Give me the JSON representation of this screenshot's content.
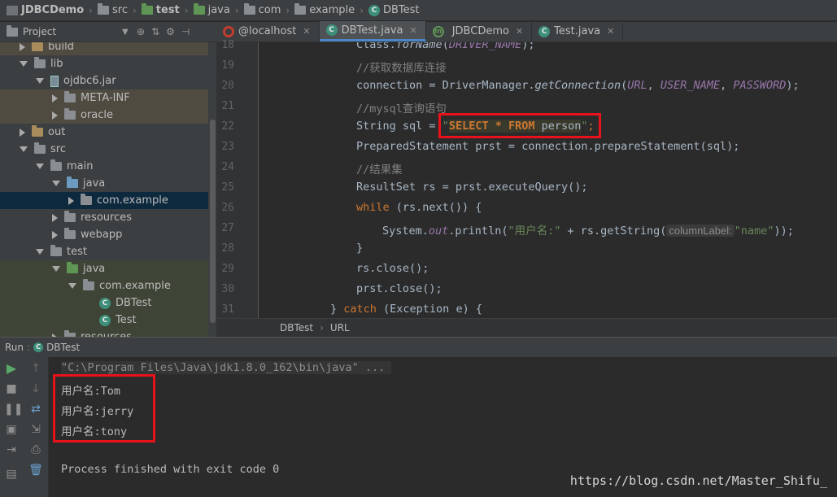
{
  "breadcrumb": {
    "project": "JDBCDemo",
    "items": [
      "src",
      "test",
      "java",
      "com",
      "example"
    ],
    "file": "DBTest"
  },
  "project_panel": {
    "title": "Project",
    "tree": [
      {
        "label": "build",
        "indent": 0
      },
      {
        "label": "lib",
        "indent": 0
      },
      {
        "label": "ojdbc6.jar",
        "indent": 1
      },
      {
        "label": "META-INF",
        "indent": 2
      },
      {
        "label": "oracle",
        "indent": 2
      },
      {
        "label": "out",
        "indent": 0
      },
      {
        "label": "src",
        "indent": 0
      },
      {
        "label": "main",
        "indent": 1
      },
      {
        "label": "java",
        "indent": 2
      },
      {
        "label": "com.example",
        "indent": 3
      },
      {
        "label": "resources",
        "indent": 2
      },
      {
        "label": "webapp",
        "indent": 2
      },
      {
        "label": "test",
        "indent": 1
      },
      {
        "label": "java",
        "indent": 2
      },
      {
        "label": "com.example",
        "indent": 3
      },
      {
        "label": "DBTest",
        "indent": 4
      },
      {
        "label": "Test",
        "indent": 4
      },
      {
        "label": "resources",
        "indent": 2
      }
    ]
  },
  "editor_tabs": [
    {
      "label": "@localhost"
    },
    {
      "label": "DBTest.java"
    },
    {
      "label": "JDBCDemo"
    },
    {
      "label": "Test.java"
    }
  ],
  "editor": {
    "line_numbers": [
      "18",
      "19",
      "20",
      "21",
      "22",
      "23",
      "24",
      "25",
      "26",
      "27",
      "28",
      "29",
      "30",
      "31"
    ],
    "code": {
      "l18_a": "Class.",
      "l18_b": "forName",
      "l18_c": "(",
      "l18_d": "DRIVER_NAME",
      "l18_e": ");",
      "l19": "//获取数据库连接",
      "l20_a": "connection = DriverManager.",
      "l20_b": "getConnection",
      "l20_c": "(",
      "l20_d": "URL",
      "l20_e": ", ",
      "l20_f": "USER_NAME",
      "l20_g": ", ",
      "l20_h": "PASSWORD",
      "l20_i": ");",
      "l21": "//mysql查询语句",
      "l22_a": "String sql = ",
      "l22_q1": "\"",
      "l22_b": "SELECT * FROM",
      "l22_c": " person",
      "l22_q2": "\"",
      "l22_d": ";",
      "l23": "PreparedStatement prst = connection.prepareStatement(sql);",
      "l24": "//结果集",
      "l25": "ResultSet rs = prst.executeQuery();",
      "l26_a": "while",
      "l26_b": " (rs.next()) {",
      "l27_a": "System.",
      "l27_b": "out",
      "l27_c": ".println(",
      "l27_d": "\"用户名:\"",
      "l27_e": " + rs.getString(",
      "l27_hint": "columnLabel:",
      "l27_f": "\"name\"",
      "l27_g": "));",
      "l28": "}",
      "l29": "rs.close();",
      "l30": "prst.close();",
      "l31_a": "} ",
      "l31_b": "catch",
      "l31_c": " (Exception e) {"
    }
  },
  "editor_breadcrumb": [
    "DBTest",
    "URL"
  ],
  "run": {
    "label": "Run",
    "config": "DBTest",
    "console": {
      "command": "\"C:\\Program Files\\Java\\jdk1.8.0_162\\bin\\java\" ...",
      "output": [
        "用户名:Tom",
        "用户名:jerry",
        "用户名:tony"
      ],
      "exit": "Process finished with exit code 0"
    }
  },
  "watermark": "https://blog.csdn.net/Master_Shifu_",
  "colors": {
    "highlight_box": "#e8121a",
    "keyword": "#cc7832",
    "string": "#6a8759",
    "constant": "#9876aa",
    "comment": "#808080",
    "active_tab_underline": "#4a88c7"
  }
}
